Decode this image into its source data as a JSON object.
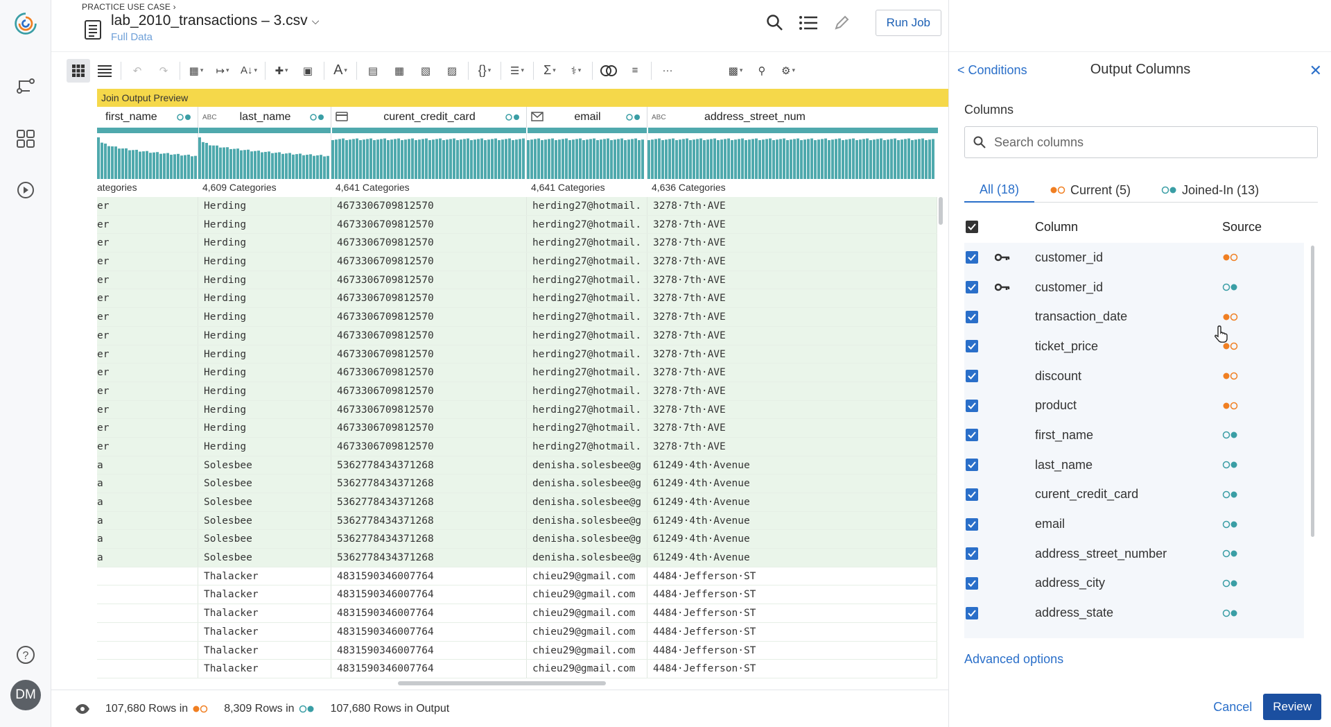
{
  "header": {
    "breadcrumb": "PRACTICE USE CASE  ›",
    "title": "lab_2010_transactions – 3.csv",
    "subtitle": "Full Data",
    "run_job_label": "Run Job"
  },
  "toolbar": {
    "overflow_label": "···"
  },
  "grid": {
    "banner": "Join Output Preview",
    "columns": [
      {
        "name": "first_name",
        "type_icon": "",
        "categories": "ategories"
      },
      {
        "name": "last_name",
        "type_icon": "ABC",
        "categories": "4,609 Categories"
      },
      {
        "name": "curent_credit_card",
        "type_icon": "card",
        "categories": "4,641 Categories"
      },
      {
        "name": "email",
        "type_icon": "mail",
        "categories": "4,641 Categories"
      },
      {
        "name": "address_street_num",
        "type_icon": "ABC",
        "categories": "4,636 Categories"
      }
    ],
    "rows": [
      [
        "er",
        "Herding",
        "4673306709812570",
        "herding27@hotmail.",
        "3278·7th·AVE"
      ],
      [
        "er",
        "Herding",
        "4673306709812570",
        "herding27@hotmail.",
        "3278·7th·AVE"
      ],
      [
        "er",
        "Herding",
        "4673306709812570",
        "herding27@hotmail.",
        "3278·7th·AVE"
      ],
      [
        "er",
        "Herding",
        "4673306709812570",
        "herding27@hotmail.",
        "3278·7th·AVE"
      ],
      [
        "er",
        "Herding",
        "4673306709812570",
        "herding27@hotmail.",
        "3278·7th·AVE"
      ],
      [
        "er",
        "Herding",
        "4673306709812570",
        "herding27@hotmail.",
        "3278·7th·AVE"
      ],
      [
        "er",
        "Herding",
        "4673306709812570",
        "herding27@hotmail.",
        "3278·7th·AVE"
      ],
      [
        "er",
        "Herding",
        "4673306709812570",
        "herding27@hotmail.",
        "3278·7th·AVE"
      ],
      [
        "er",
        "Herding",
        "4673306709812570",
        "herding27@hotmail.",
        "3278·7th·AVE"
      ],
      [
        "er",
        "Herding",
        "4673306709812570",
        "herding27@hotmail.",
        "3278·7th·AVE"
      ],
      [
        "er",
        "Herding",
        "4673306709812570",
        "herding27@hotmail.",
        "3278·7th·AVE"
      ],
      [
        "er",
        "Herding",
        "4673306709812570",
        "herding27@hotmail.",
        "3278·7th·AVE"
      ],
      [
        "er",
        "Herding",
        "4673306709812570",
        "herding27@hotmail.",
        "3278·7th·AVE"
      ],
      [
        "er",
        "Herding",
        "4673306709812570",
        "herding27@hotmail.",
        "3278·7th·AVE"
      ],
      [
        "a",
        "Solesbee",
        "5362778434371268",
        "denisha.solesbee@g",
        "61249·4th·Avenue"
      ],
      [
        "a",
        "Solesbee",
        "5362778434371268",
        "denisha.solesbee@g",
        "61249·4th·Avenue"
      ],
      [
        "a",
        "Solesbee",
        "5362778434371268",
        "denisha.solesbee@g",
        "61249·4th·Avenue"
      ],
      [
        "a",
        "Solesbee",
        "5362778434371268",
        "denisha.solesbee@g",
        "61249·4th·Avenue"
      ],
      [
        "a",
        "Solesbee",
        "5362778434371268",
        "denisha.solesbee@g",
        "61249·4th·Avenue"
      ],
      [
        "a",
        "Solesbee",
        "5362778434371268",
        "denisha.solesbee@g",
        "61249·4th·Avenue"
      ],
      [
        "",
        "Thalacker",
        "4831590346007764",
        "chieu29@gmail.com",
        "4484·Jefferson·ST"
      ],
      [
        "",
        "Thalacker",
        "4831590346007764",
        "chieu29@gmail.com",
        "4484·Jefferson·ST"
      ],
      [
        "",
        "Thalacker",
        "4831590346007764",
        "chieu29@gmail.com",
        "4484·Jefferson·ST"
      ],
      [
        "",
        "Thalacker",
        "4831590346007764",
        "chieu29@gmail.com",
        "4484·Jefferson·ST"
      ],
      [
        "",
        "Thalacker",
        "4831590346007764",
        "chieu29@gmail.com",
        "4484·Jefferson·ST"
      ],
      [
        "",
        "Thalacker",
        "4831590346007764",
        "chieu29@gmail.com",
        "4484·Jefferson·ST"
      ]
    ]
  },
  "footer": {
    "rows_current": "107,680 Rows in",
    "rows_joined": "8,309 Rows in",
    "rows_output": "107,680 Rows in Output"
  },
  "panel": {
    "back_label": "< Conditions",
    "title": "Output Columns",
    "columns_label": "Columns",
    "search_placeholder": "Search columns",
    "tabs": [
      {
        "label": "All (18)",
        "active": true
      },
      {
        "label": "Current (5)",
        "active": false
      },
      {
        "label": "Joined-In (13)",
        "active": false
      }
    ],
    "col_header": "Column",
    "src_header": "Source",
    "columns": [
      {
        "name": "customer_id",
        "key": true,
        "source": "current"
      },
      {
        "name": "customer_id",
        "key": true,
        "source": "joined"
      },
      {
        "name": "transaction_date",
        "key": false,
        "source": "current"
      },
      {
        "name": "ticket_price",
        "key": false,
        "source": "current"
      },
      {
        "name": "discount",
        "key": false,
        "source": "current"
      },
      {
        "name": "product",
        "key": false,
        "source": "current"
      },
      {
        "name": "first_name",
        "key": false,
        "source": "joined"
      },
      {
        "name": "last_name",
        "key": false,
        "source": "joined"
      },
      {
        "name": "curent_credit_card",
        "key": false,
        "source": "joined"
      },
      {
        "name": "email",
        "key": false,
        "source": "joined"
      },
      {
        "name": "address_street_number",
        "key": false,
        "source": "joined"
      },
      {
        "name": "address_city",
        "key": false,
        "source": "joined"
      },
      {
        "name": "address_state",
        "key": false,
        "source": "joined"
      }
    ],
    "advanced_label": "Advanced options",
    "cancel_label": "Cancel",
    "review_label": "Review"
  },
  "user": {
    "initials": "DM"
  },
  "colors": {
    "accent": "#2a6fc9",
    "current": "#f07f22",
    "joined": "#3a9ea5",
    "banner": "#f5d84a",
    "joined_row": "#eaf5ea"
  }
}
